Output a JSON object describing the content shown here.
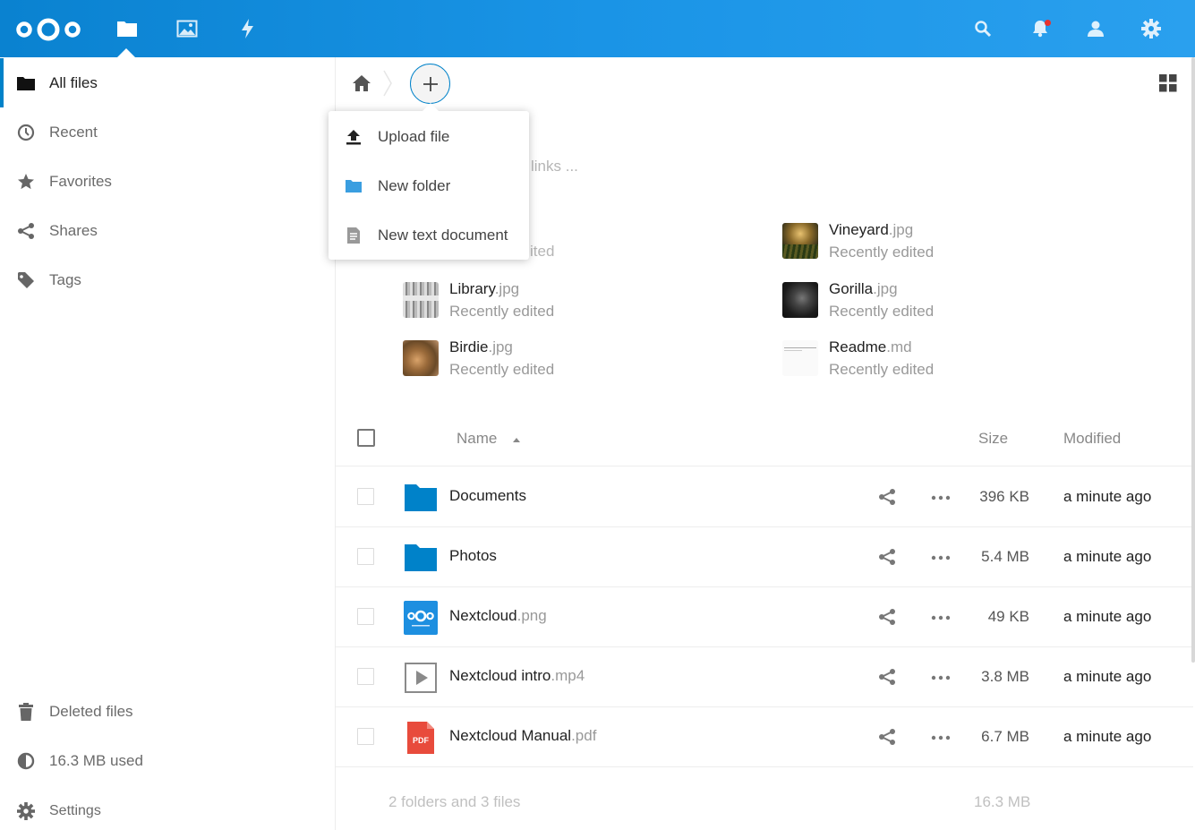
{
  "colors": {
    "brand": "#0082c9",
    "folder": "#0082c9",
    "pdf": "#e84b3c",
    "notification_dot": "#e9322d"
  },
  "header": {
    "apps": [
      {
        "name": "files",
        "icon": "folder-icon",
        "active": true
      },
      {
        "name": "gallery",
        "icon": "image-icon",
        "active": false
      },
      {
        "name": "activity",
        "icon": "lightning-icon",
        "active": false
      }
    ],
    "right_icons": [
      "search-icon",
      "bell-icon",
      "contacts-icon",
      "gear-icon"
    ]
  },
  "sidebar": {
    "items": [
      {
        "label": "All files",
        "icon": "folder-icon",
        "active": true
      },
      {
        "label": "Recent",
        "icon": "clock-icon"
      },
      {
        "label": "Favorites",
        "icon": "star-icon"
      },
      {
        "label": "Shares",
        "icon": "share-icon"
      },
      {
        "label": "Tags",
        "icon": "tag-icon"
      }
    ],
    "bottom": [
      {
        "label": "Deleted files",
        "icon": "trash-icon"
      },
      {
        "label": "16.3 MB used",
        "icon": "pie-icon"
      },
      {
        "label": "Settings",
        "icon": "gear-icon"
      }
    ]
  },
  "new_menu": {
    "items": [
      {
        "label": "Upload file",
        "icon": "upload-icon"
      },
      {
        "label": "New folder",
        "icon": "folder-icon"
      },
      {
        "label": "New text document",
        "icon": "document-icon"
      }
    ]
  },
  "partially_hidden": {
    "links_text": "links ...",
    "edited_text": "ited"
  },
  "recent": [
    {
      "name": "Vineyard",
      "ext": ".jpg",
      "sub": "Recently edited"
    },
    {
      "name": "Library",
      "ext": ".jpg",
      "sub": "Recently edited"
    },
    {
      "name": "Gorilla",
      "ext": ".jpg",
      "sub": "Recently edited"
    },
    {
      "name": "Birdie",
      "ext": ".jpg",
      "sub": "Recently edited"
    },
    {
      "name": "Readme",
      "ext": ".md",
      "sub": "Recently edited"
    }
  ],
  "table": {
    "columns": {
      "name": "Name",
      "size": "Size",
      "modified": "Modified"
    },
    "rows": [
      {
        "name": "Documents",
        "ext": "",
        "type": "folder",
        "size": "396 KB",
        "modified": "a minute ago"
      },
      {
        "name": "Photos",
        "ext": "",
        "type": "folder",
        "size": "5.4 MB",
        "modified": "a minute ago"
      },
      {
        "name": "Nextcloud",
        "ext": ".png",
        "type": "image",
        "size": "49 KB",
        "modified": "a minute ago"
      },
      {
        "name": "Nextcloud intro",
        "ext": ".mp4",
        "type": "video",
        "size": "3.8 MB",
        "modified": "a minute ago"
      },
      {
        "name": "Nextcloud Manual",
        "ext": ".pdf",
        "type": "pdf",
        "pdf_label": "PDF",
        "size": "6.7 MB",
        "modified": "a minute ago"
      }
    ],
    "summary": "2 folders and 3 files",
    "summary_size": "16.3 MB"
  }
}
